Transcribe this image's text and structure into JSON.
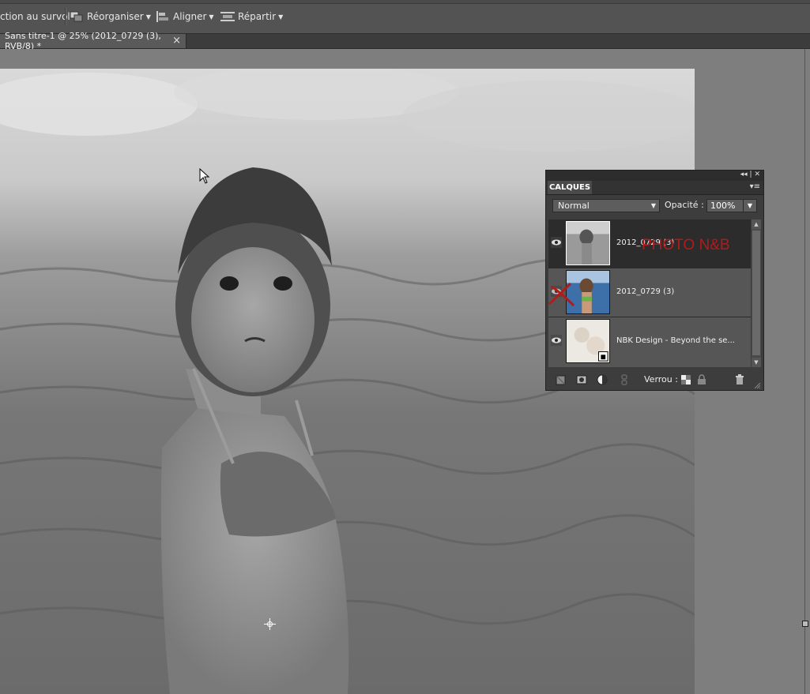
{
  "toolbar": {
    "survol_label": "ction au survol",
    "reorganiser_label": "Réorganiser",
    "aligner_label": "Aligner",
    "repartir_label": "Répartir"
  },
  "document_tab": {
    "title": "Sans titre-1 @ 25% (2012_0729 (3), RVB/8) *",
    "close_glyph": "×"
  },
  "layers_panel": {
    "tab_label": "CALQUES",
    "blend_mode": "Normal",
    "opacity_label": "Opacité :",
    "opacity_value": "100%",
    "lock_label": "Verrou :",
    "layers": [
      {
        "name": "2012_0729 (3)",
        "overlay_text": "PHOTO N&B",
        "selected": true,
        "visible": true
      },
      {
        "name": "2012_0729 (3)",
        "selected": false,
        "visible": false
      },
      {
        "name": "NBK Design - Beyond the se...",
        "selected": false,
        "visible": true
      }
    ]
  },
  "colors": {
    "annotation_red": "#b31b1b",
    "panel_bg": "#3d3d3d",
    "workspace_bg": "#7e7e7e"
  }
}
